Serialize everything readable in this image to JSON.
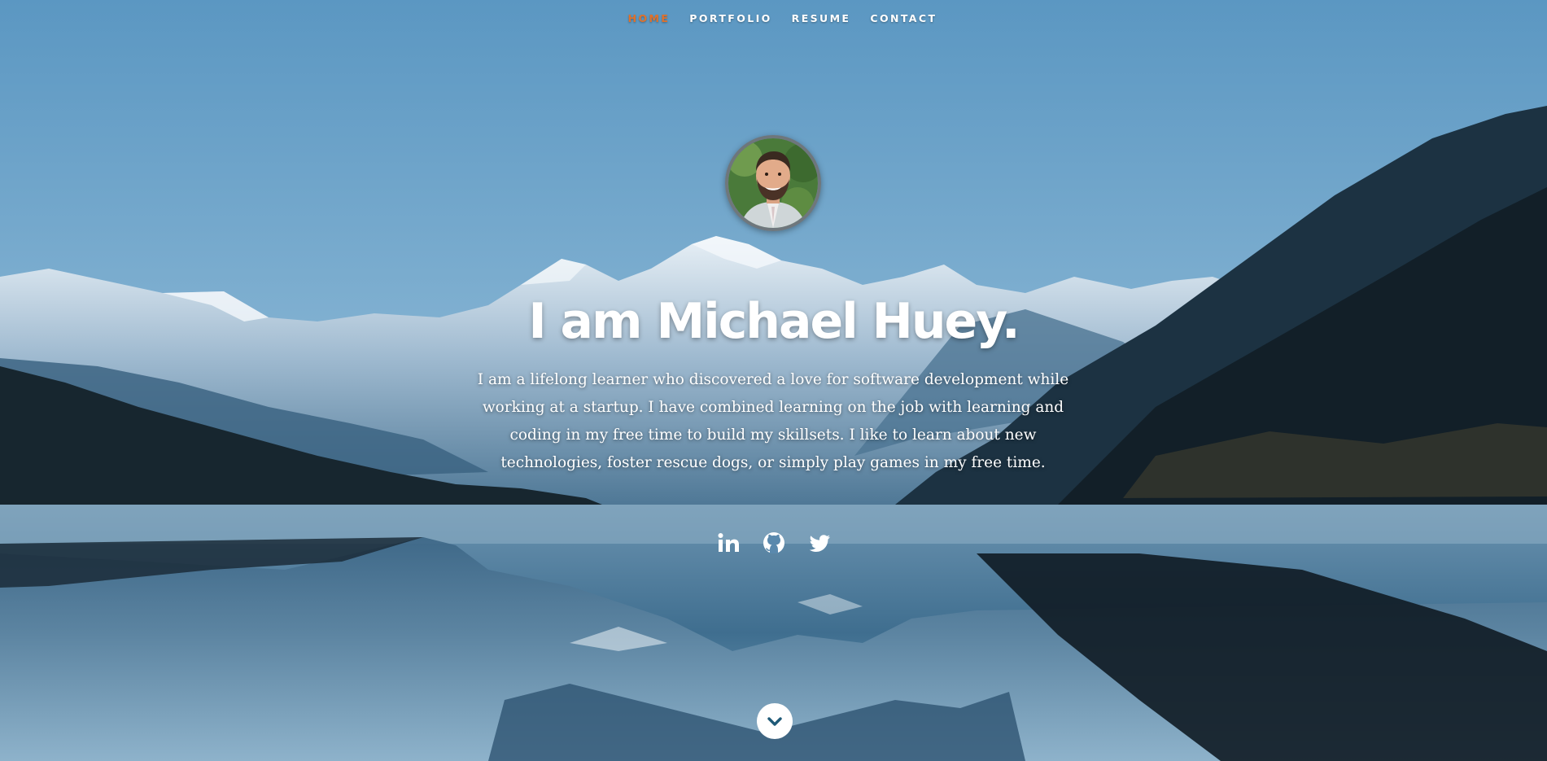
{
  "nav": {
    "items": [
      {
        "label": "HOME",
        "active": true
      },
      {
        "label": "PORTFOLIO",
        "active": false
      },
      {
        "label": "RESUME",
        "active": false
      },
      {
        "label": "CONTACT",
        "active": false
      }
    ]
  },
  "colors": {
    "accent": "#e0712b",
    "text": "#ffffff",
    "sky": "#5f9dc7",
    "scroll_arrow": "#1f5a78"
  },
  "hero": {
    "headline": "I am Michael Huey.",
    "bio": "I am a lifelong learner who discovered a love for software development while working at a startup. I have combined learning on the job with learning and coding in my free time to build my skillsets. I like to learn about new technologies, foster rescue dogs, or simply play games in my free time."
  },
  "social": {
    "icons": [
      "linkedin-icon",
      "github-icon",
      "twitter-icon"
    ]
  },
  "scroll": {
    "icon": "chevron-down-icon"
  }
}
